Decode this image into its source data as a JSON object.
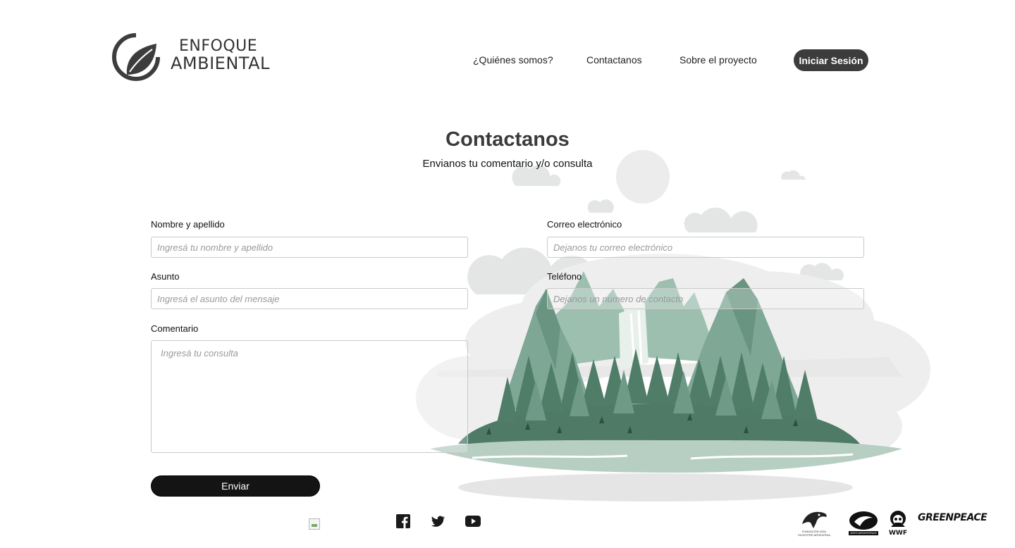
{
  "header": {
    "logo_line1": "ENFOQUE",
    "logo_line2": "AMBIENTAL",
    "nav": [
      {
        "label": "¿Quiénes somos?"
      },
      {
        "label": "Contactanos"
      },
      {
        "label": "Sobre el proyecto"
      }
    ],
    "login_label": "Iniciar Sesión"
  },
  "page": {
    "title": "Contactanos",
    "subtitle": "Envianos tu comentario y/o consulta"
  },
  "form": {
    "name": {
      "label": "Nombre y apellido",
      "placeholder": "Ingresá tu nombre y apellido"
    },
    "email": {
      "label": "Correo electrónico",
      "placeholder": "Dejanos tu correo electrónico"
    },
    "subject": {
      "label": "Asunto",
      "placeholder": "Ingresá el asunto del mensaje"
    },
    "phone": {
      "label": "Teléfono",
      "placeholder": "Dejanos un número de contacto"
    },
    "comment": {
      "label": "Comentario",
      "placeholder": "Ingresá tu consulta"
    },
    "submit_label": "Enviar"
  },
  "footer": {
    "social_icons": [
      "facebook-icon",
      "twitter-icon",
      "youtube-icon"
    ],
    "partners": [
      {
        "name": "fundacion-vida-silvestre-logo",
        "text": "FUNDACIÓN VIDA SILVESTRE ARGENTINA"
      },
      {
        "name": "aves-argentinas-logo",
        "text": "AVES ARGENTINAS"
      },
      {
        "name": "wwf-logo",
        "text": "WWF"
      },
      {
        "name": "greenpeace-logo",
        "text": "GREENPEACE"
      }
    ]
  },
  "colors": {
    "primary_dark": "#3c3c3c",
    "button_black": "#141414",
    "illustration_green": "#6f9a88",
    "illustration_dark_green": "#4e7a66",
    "cloud_grey": "#e6e6e6"
  }
}
